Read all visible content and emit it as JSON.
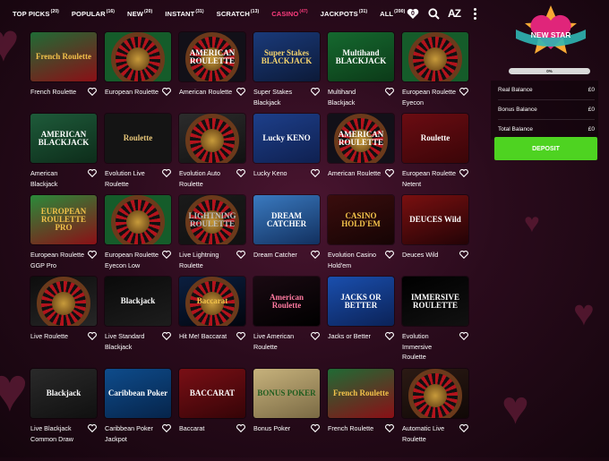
{
  "nav": {
    "tabs": [
      {
        "label": "TOP PICKS",
        "count": "(20)"
      },
      {
        "label": "POPULAR",
        "count": "(16)"
      },
      {
        "label": "NEW",
        "count": "(20)"
      },
      {
        "label": "INSTANT",
        "count": "(31)"
      },
      {
        "label": "SCRATCH",
        "count": "(13)"
      },
      {
        "label": "CASINO",
        "count": "(47)",
        "active": true
      },
      {
        "label": "JACKPOTS",
        "count": "(31)"
      },
      {
        "label": "ALL",
        "count": "(390)"
      }
    ],
    "favourites_count": "0",
    "sort_label": "AZ",
    "accent_color": "#ff3d7f"
  },
  "games": [
    {
      "title": "French Roulette",
      "thumb": "French Roulette"
    },
    {
      "title": "European Roulette",
      "thumb": ""
    },
    {
      "title": "American Roulette",
      "thumb": "AMERICAN ROULETTE"
    },
    {
      "title": "Super Stakes Blackjack",
      "thumb": "Super Stakes BLACKJACK"
    },
    {
      "title": "Multihand Blackjack",
      "thumb": "Multihand BLACKJACK"
    },
    {
      "title": "European Roulette Eyecon",
      "thumb": ""
    },
    {
      "title": "American Blackjack",
      "thumb": "AMERICAN BLACKJACK"
    },
    {
      "title": "Evolution Live Roulette",
      "thumb": "Roulette"
    },
    {
      "title": "Evolution Auto Roulette",
      "thumb": ""
    },
    {
      "title": "Lucky Keno",
      "thumb": "Lucky KENO"
    },
    {
      "title": "American Roulette",
      "thumb": "AMERICAN ROULETTE"
    },
    {
      "title": "European Roulette Netent",
      "thumb": "Roulette"
    },
    {
      "title": "European Roulette GGP Pro",
      "thumb": "EUROPEAN ROULETTE PRO"
    },
    {
      "title": "European Roulette Eyecon Low",
      "thumb": ""
    },
    {
      "title": "Live Lightning Roulette",
      "thumb": "LIGHTNING ROULETTE"
    },
    {
      "title": "Dream Catcher",
      "thumb": "DREAM CATCHER"
    },
    {
      "title": "Evolution Casino Hold'em",
      "thumb": "CASINO HOLD'EM"
    },
    {
      "title": "Deuces Wild",
      "thumb": "DEUCES Wild"
    },
    {
      "title": "Live Roulette",
      "thumb": ""
    },
    {
      "title": "Live Standard Blackjack",
      "thumb": "Blackjack"
    },
    {
      "title": "Hit Me! Baccarat",
      "thumb": "Baccarat"
    },
    {
      "title": "Live American Roulette",
      "thumb": "American Roulette"
    },
    {
      "title": "Jacks or Better",
      "thumb": "JACKS OR BETTER"
    },
    {
      "title": "Evolution Immersive Roulette",
      "thumb": "IMMERSIVE ROULETTE"
    },
    {
      "title": "Live Blackjack Common Draw",
      "thumb": "Blackjack"
    },
    {
      "title": "Caribbean Poker Jackpot",
      "thumb": "Caribbean Poker"
    },
    {
      "title": "Baccarat",
      "thumb": "BACCARAT"
    },
    {
      "title": "Bonus Poker",
      "thumb": "BONUS POKER"
    },
    {
      "title": "French Roulette",
      "thumb": "French Roulette"
    },
    {
      "title": "Automatic Live Roulette",
      "thumb": ""
    }
  ],
  "profile": {
    "badge_label": "NEW STAR",
    "progress_percent": 0,
    "progress_text": "0%",
    "balances": [
      {
        "label": "Real Balance",
        "value": "£0"
      },
      {
        "label": "Bonus Balance",
        "value": "£0"
      },
      {
        "label": "Total Balance",
        "value": "£0"
      }
    ],
    "deposit_label": "DEPOSIT",
    "deposit_color": "#4ed321"
  }
}
